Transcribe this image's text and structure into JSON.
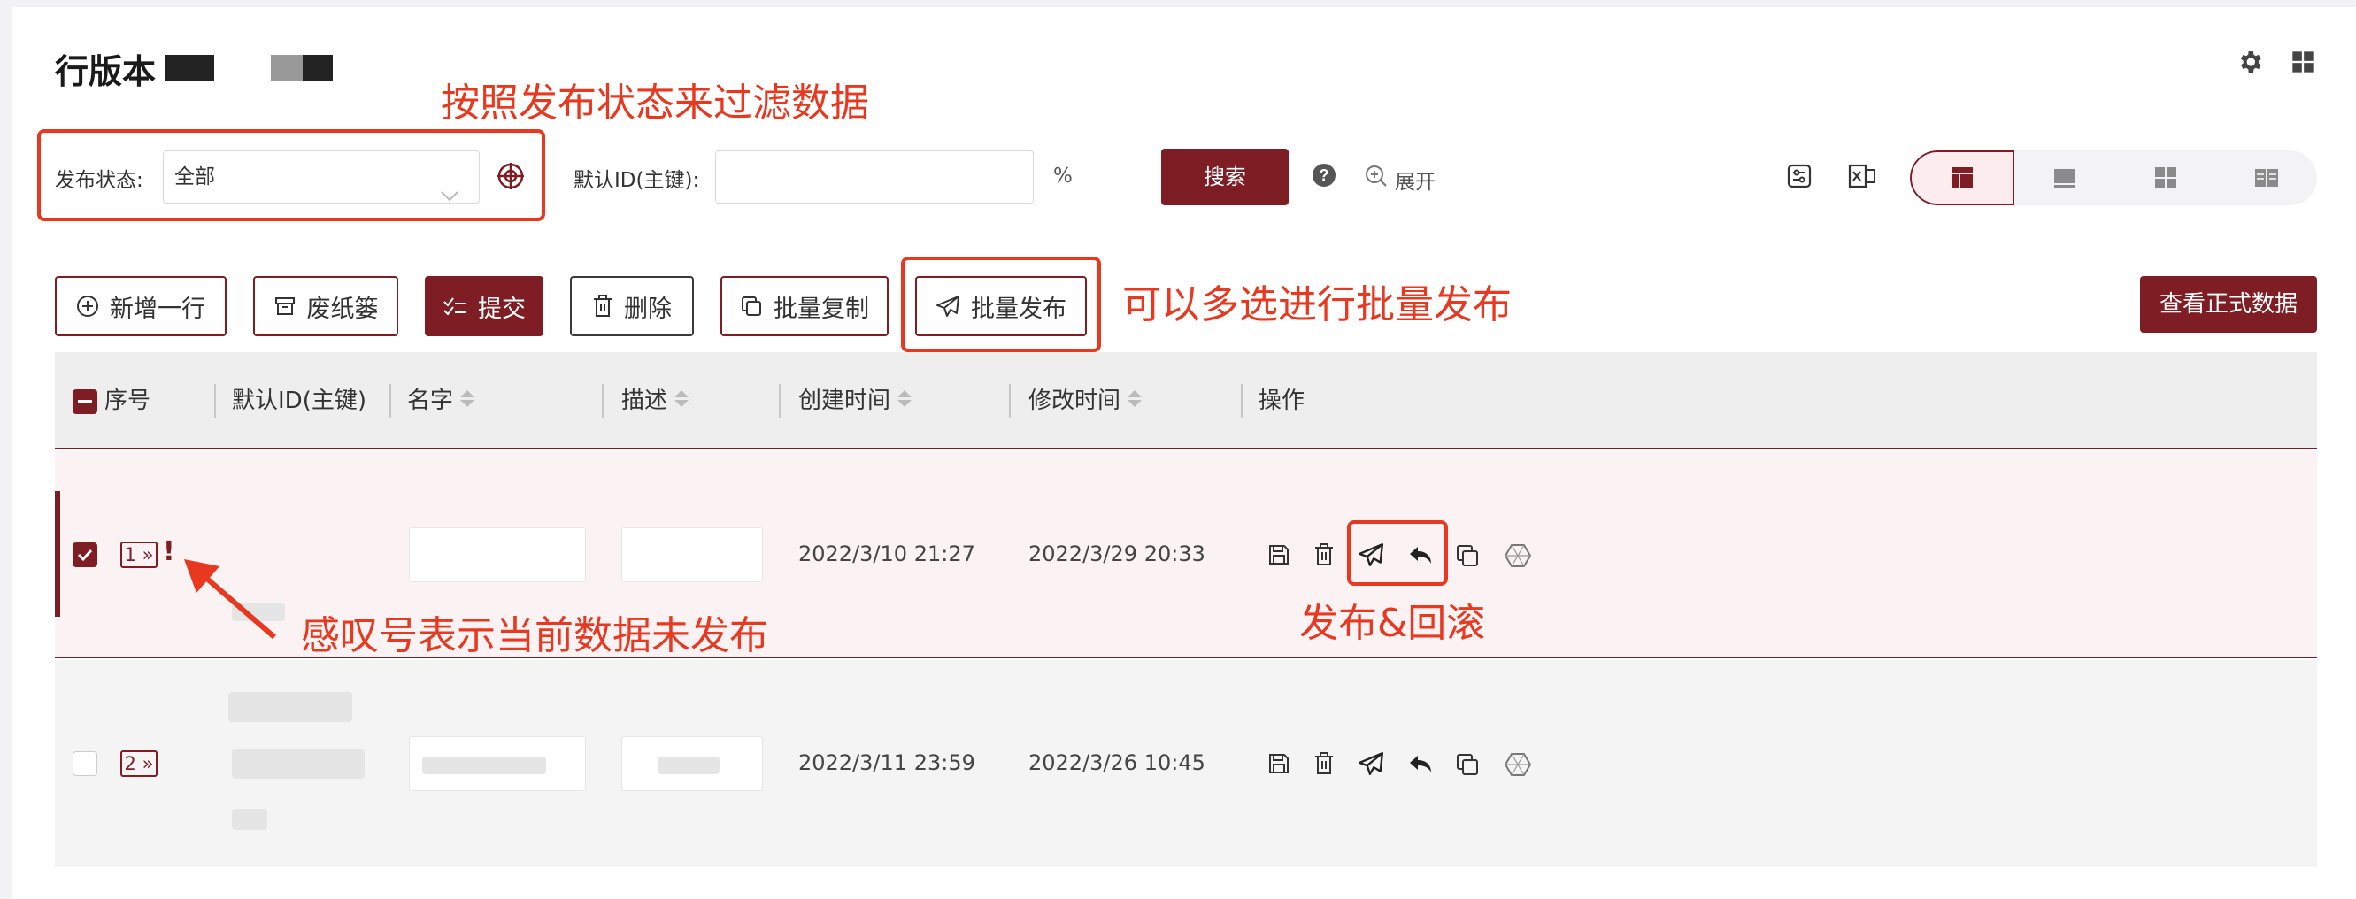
{
  "header": {
    "title": "行版本"
  },
  "filters": {
    "publish_status_label": "发布状态:",
    "publish_status_value": "全部",
    "default_id_label": "默认ID(主键):",
    "default_id_value": "",
    "percent": "%",
    "search_label": "搜索",
    "expand_label": "展开"
  },
  "toolbar": {
    "add_row": "新增一行",
    "wastebasket": "废纸篓",
    "submit": "提交",
    "delete": "删除",
    "batch_copy": "批量复制",
    "batch_publish": "批量发布",
    "view_official": "查看正式数据"
  },
  "table": {
    "columns": [
      "序号",
      "默认ID(主键)",
      "名字",
      "描述",
      "创建时间",
      "修改时间",
      "操作"
    ],
    "rows": [
      {
        "index": "1 »",
        "unpublished_mark": "!",
        "created": "2022/3/10 21:27",
        "modified": "2022/3/29 20:33",
        "selected": true
      },
      {
        "index": "2 »",
        "unpublished_mark": "",
        "created": "2022/3/11 23:59",
        "modified": "2022/3/26 10:45",
        "selected": false
      }
    ]
  },
  "annotations": {
    "filter_note": "按照发布状态来过滤数据",
    "batch_note": "可以多选进行批量发布",
    "unpublished_note": "感叹号表示当前数据未发布",
    "publish_rollback_note": "发布&回滚"
  },
  "colors": {
    "brand": "#7e1d24",
    "annotation": "#e8381f"
  }
}
